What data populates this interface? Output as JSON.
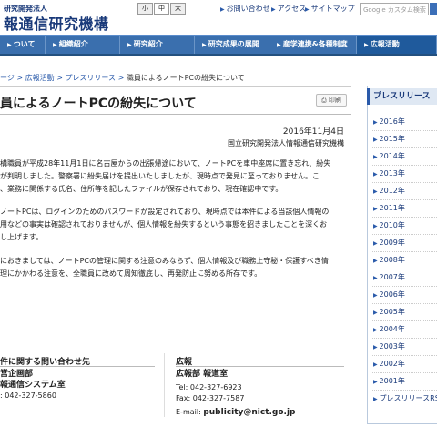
{
  "header": {
    "org_line": "研究開発法人",
    "org_name": "報通信研究機構",
    "font_sizes": [
      "小",
      "中",
      "大"
    ],
    "links": [
      "お問い合わせ",
      "アクセス",
      "サイトマップ"
    ],
    "search_placeholder": "Google カスタム検索"
  },
  "nav": [
    "ついて",
    "組織紹介",
    "研究紹介",
    "研究成果の展開",
    "産学連携&各種制度",
    "広報活動"
  ],
  "breadcrumb": {
    "items": [
      "ージ",
      "広報活動",
      "プレスリリース"
    ],
    "current": "職員によるノートPCの紛失について"
  },
  "article": {
    "title": "員によるノートPCの紛失について",
    "print_label": "印刷",
    "date": "2016年11月4日",
    "org": "国立研究開発法人情報通信研究機構",
    "para1": [
      "構職員が平成28年11月1日に名古屋からの出張帰途において、ノートPCを車中座席に置き忘れ、紛失",
      "が判明しました。警察署に紛失届けを提出いたしましたが、現時点で発見に至っておりません。こ",
      "、業務に関係する氏名、住所等を記したファイルが保存されており、現在確認中です。"
    ],
    "para2": [
      "ノートPCは、ログインのためのパスワードが設定されており、現時点では本件による当該個人情報の",
      "用などの事実は確認されておりませんが、個人情報を紛失するという事態を招きましたことを深くお",
      "し上げます。"
    ],
    "para3": [
      "におきましては、ノートPCの管理に関する注意のみならず、個人情報及び職務上守秘・保護すべき情",
      "理にかかわる注意を、全職員に改めて周知徹底し、再発防止に努める所存です。"
    ]
  },
  "contact_left": {
    "heading": "件に関する問い合わせ先",
    "dept": "営企画部",
    "section": "報通信システム室",
    "tel": ": 042-327-5860"
  },
  "contact_right": {
    "heading": "広報",
    "dept": "広報部 報道室",
    "tel": "Tel: 042-327-6923",
    "fax": "Fax: 042-327-7587",
    "email_label": "E-mail:",
    "email": "publicity@nict.go.jp"
  },
  "sidebar": {
    "heading": "プレスリリース",
    "years": [
      "2016年",
      "2015年",
      "2014年",
      "2013年",
      "2012年",
      "2011年",
      "2010年",
      "2009年",
      "2008年",
      "2007年",
      "2006年",
      "2005年",
      "2004年",
      "2003年",
      "2002年",
      "2001年"
    ],
    "rss": "プレスリリースRSS"
  }
}
